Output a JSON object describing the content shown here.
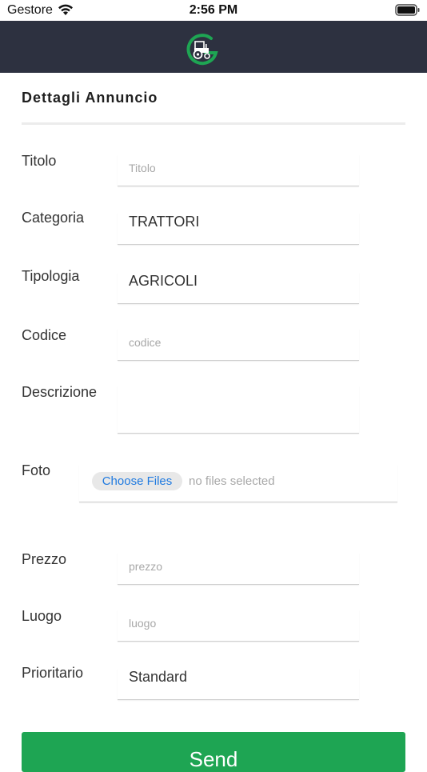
{
  "status_bar": {
    "carrier": "Gestore",
    "time": "2:56 PM",
    "wifi_icon": "wifi-icon",
    "battery_icon": "battery-full-icon"
  },
  "header": {
    "logo_icon": "tractor-logo-icon",
    "brand_color": "#2d3140",
    "logo_accent": "#1ea553"
  },
  "form": {
    "section_title": "Dettagli Annuncio",
    "fields": {
      "titolo": {
        "label": "Titolo",
        "placeholder": "Titolo",
        "value": ""
      },
      "categoria": {
        "label": "Categoria",
        "value": "TRATTORI"
      },
      "tipologia": {
        "label": "Tipologia",
        "value": "AGRICOLI"
      },
      "codice": {
        "label": "Codice",
        "placeholder": "codice",
        "value": ""
      },
      "descrizione": {
        "label": "Descrizione",
        "placeholder": "",
        "value": ""
      },
      "foto": {
        "label": "Foto",
        "button": "Choose Files",
        "status": "no files selected"
      },
      "prezzo": {
        "label": "Prezzo",
        "placeholder": "prezzo",
        "value": ""
      },
      "luogo": {
        "label": "Luogo",
        "placeholder": "luogo",
        "value": ""
      },
      "prioritario": {
        "label": "Prioritario",
        "value": "Standard"
      }
    },
    "submit_label": "Send",
    "submit_color": "#1ea553"
  }
}
